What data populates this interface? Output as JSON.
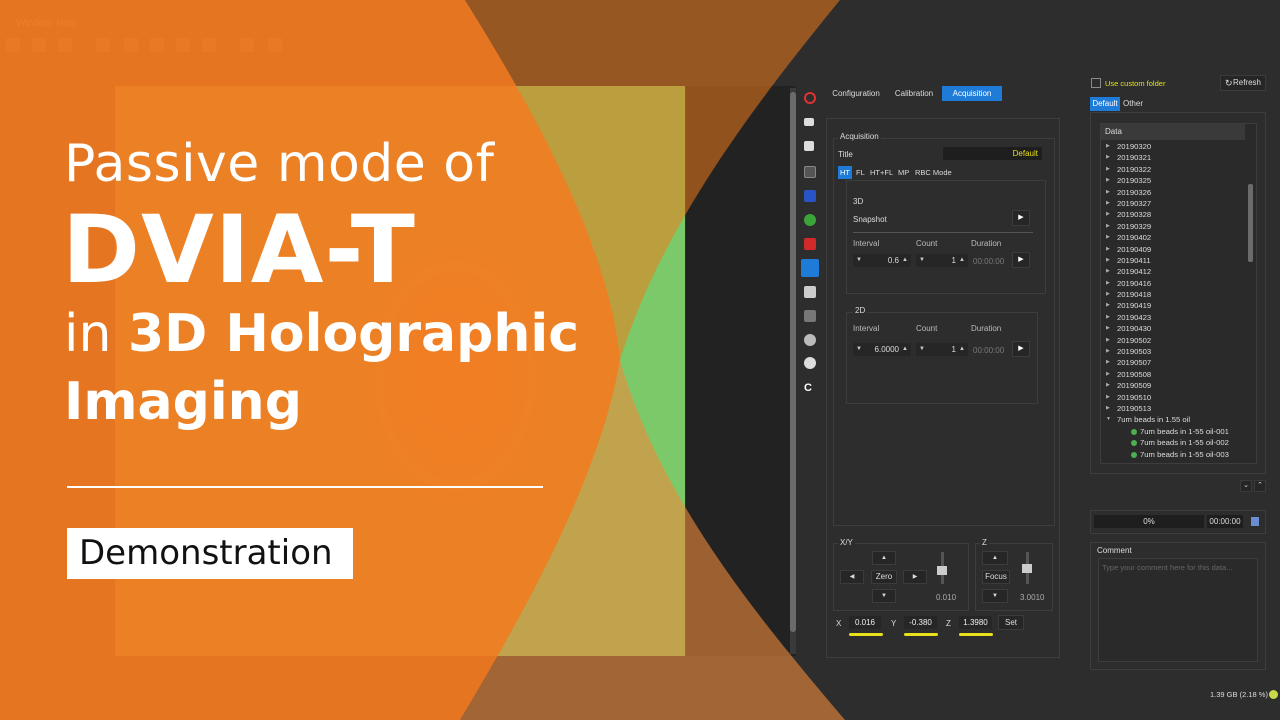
{
  "thumbnail": {
    "line1": "Passive mode of",
    "title": "DVIA-T",
    "line3_prefix": "in ",
    "line3_bold": "3D Holographic",
    "line4": "Imaging",
    "badge": "Demonstration",
    "colors": {
      "orange": "#f47b20",
      "white": "#ffffff"
    }
  },
  "menubar": {
    "items": [
      "Window",
      "Help"
    ]
  },
  "tabs": [
    {
      "label": "Configuration",
      "active": false
    },
    {
      "label": "Calibration",
      "active": false
    },
    {
      "label": "Acquisition",
      "active": true
    }
  ],
  "acquisition": {
    "group_title": "Acquisition",
    "title_label": "Title",
    "title_value": "Default",
    "mode_tabs": [
      {
        "label": "HT",
        "active": true
      },
      {
        "label": "FL",
        "active": false
      },
      {
        "label": "HT+FL",
        "active": false
      },
      {
        "label": "MP",
        "active": false
      },
      {
        "label": "RBC Mode",
        "active": false
      }
    ],
    "section_3d": {
      "title": "3D",
      "snapshot_label": "Snapshot",
      "interval_label": "Interval",
      "count_label": "Count",
      "duration_label": "Duration",
      "interval_value": "0.6",
      "count_value": "1",
      "duration_value": "00:00:00"
    },
    "section_2d": {
      "title": "2D",
      "interval_label": "Interval",
      "count_label": "Count",
      "duration_label": "Duration",
      "interval_value": "6.0000",
      "count_value": "1",
      "duration_value": "00:00:00"
    }
  },
  "stage": {
    "xy_label": "X/Y",
    "z_label": "Z",
    "zero_label": "Zero",
    "focus_label": "Focus",
    "xy_step": "0.010",
    "z_step": "3.0010",
    "x_label": "X",
    "y_label": "Y",
    "zc_label": "Z",
    "x_value": "0.016",
    "y_value": "-0.380",
    "z_value": "1.3980",
    "set_label": "Set"
  },
  "data_panel": {
    "custom_folder_label": "Use custom folder",
    "refresh_label": "Refresh",
    "tabs": [
      {
        "label": "Default",
        "active": true
      },
      {
        "label": "Other",
        "active": false
      }
    ],
    "tree_header": "Data",
    "folders": [
      "20190320",
      "20190321",
      "20190322",
      "20190325",
      "20190326",
      "20190327",
      "20190328",
      "20190329",
      "20190402",
      "20190409",
      "20190411",
      "20190412",
      "20190416",
      "20190418",
      "20190419",
      "20190423",
      "20190430",
      "20190502",
      "20190503",
      "20190507",
      "20190508",
      "20190509",
      "20190510",
      "20190513"
    ],
    "expanded_folder": "7um beads in 1.55 oil",
    "children": [
      "7um beads in 1-55 oil-001",
      "7um beads in 1-55 oil-002",
      "7um beads in 1-55 oil-003"
    ],
    "progress": "0%",
    "time": "00:00:00",
    "comment_label": "Comment",
    "comment_placeholder": "Type your comment here for this data...",
    "disk_status": "1.39 GB (2.18 %)"
  }
}
